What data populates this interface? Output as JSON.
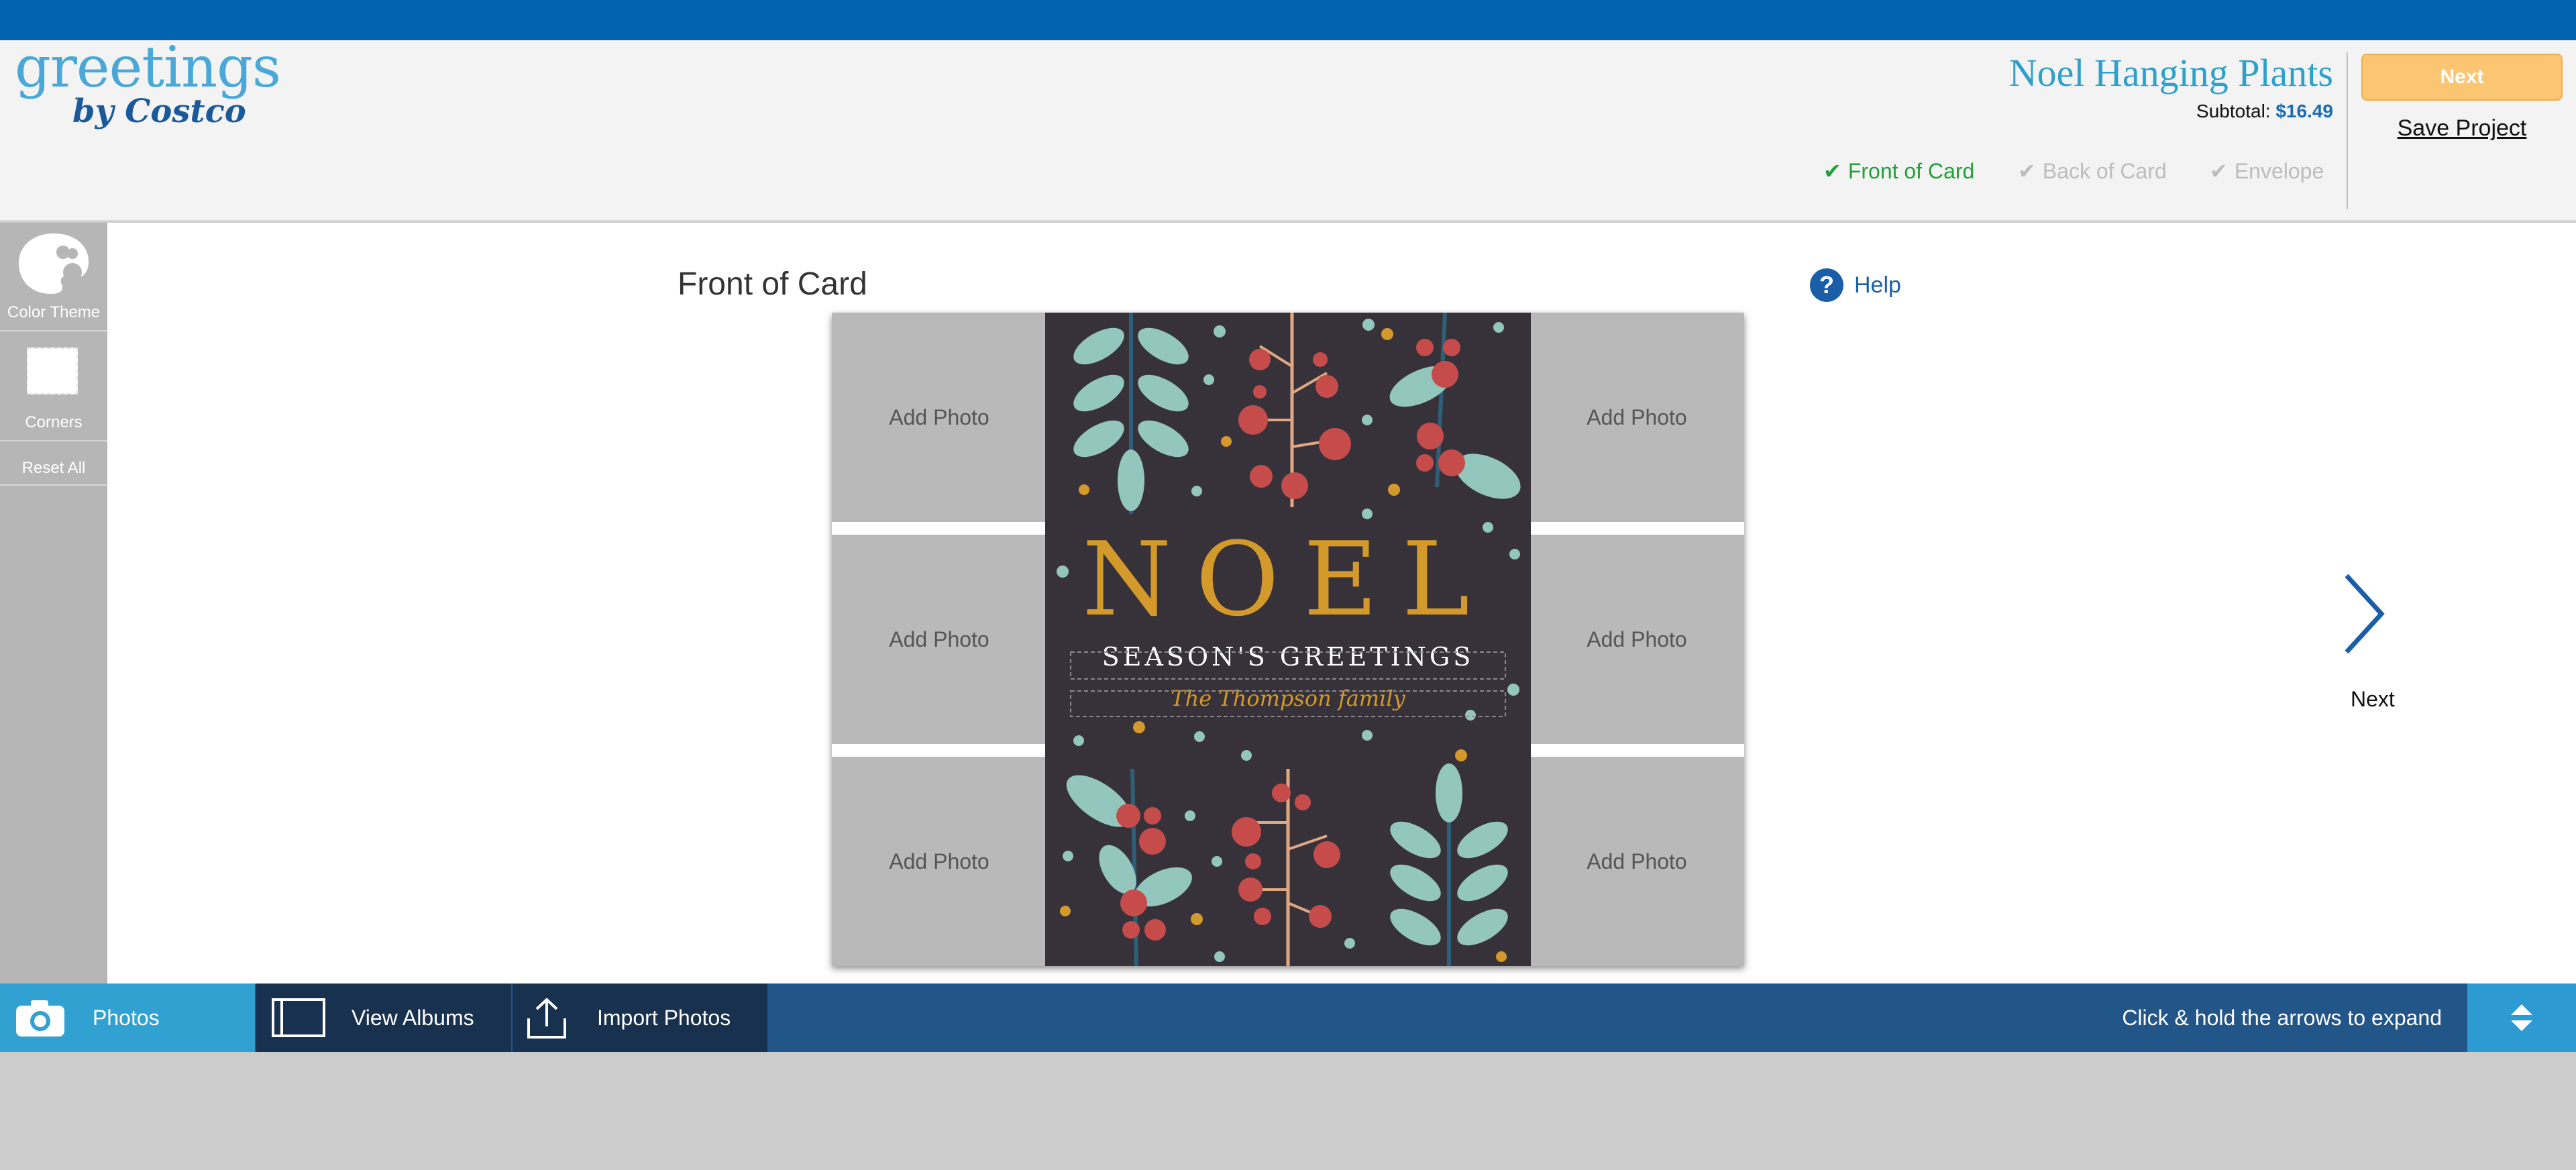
{
  "brand": {
    "logo_main": "greetings",
    "logo_sub": "by Costco"
  },
  "header": {
    "product_title": "Noel Hanging Plants",
    "subtotal_label": "Subtotal:",
    "subtotal_value": "$16.49",
    "next_button": "Next",
    "save_project": "Save Project",
    "steps": [
      {
        "label": "Front of Card",
        "state": "done"
      },
      {
        "label": "Back of Card",
        "state": "pending"
      },
      {
        "label": "Envelope",
        "state": "pending"
      }
    ]
  },
  "sidebar": {
    "items": [
      {
        "label": "Color Theme",
        "icon": "palette-icon"
      },
      {
        "label": "Corners",
        "icon": "corners-icon"
      },
      {
        "label": "Reset All"
      }
    ]
  },
  "main": {
    "section_title": "Front of Card",
    "help_label": "Help",
    "next_label": "Next",
    "photo_slot_label": "Add Photo",
    "card": {
      "headline": "NOEL",
      "greeting": "SEASON'S GREETINGS",
      "family": "The Thompson family"
    }
  },
  "toolbar": {
    "photos": "Photos",
    "view_albums": "View Albums",
    "import_photos": "Import Photos",
    "hint": "Click & hold the arrows to expand"
  },
  "colors": {
    "top_bar": "#0263b0",
    "brand_blue": "#2ea0cc",
    "next_button": "#fcc572",
    "step_done": "#22a039",
    "card_background": "#37323a",
    "berry": "#c64c4c",
    "leaf": "#93c6bd",
    "gold": "#d3992b"
  }
}
